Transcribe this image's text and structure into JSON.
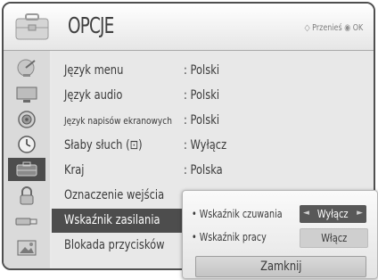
{
  "header": {
    "title": "OPCJE",
    "hint_move_symbol": "◇",
    "hint_move": "Przenieś",
    "hint_ok_symbol": "◉",
    "hint_ok": "OK"
  },
  "sidebar": {
    "items": [
      {
        "icon": "satellite-dish-icon"
      },
      {
        "icon": "monitor-icon"
      },
      {
        "icon": "speaker-icon"
      },
      {
        "icon": "clock-icon"
      },
      {
        "icon": "suitcase-icon",
        "active": true
      },
      {
        "icon": "lock-icon"
      },
      {
        "icon": "usb-icon"
      },
      {
        "icon": "photo-icon"
      }
    ]
  },
  "menu": {
    "items": [
      {
        "label": "Język menu",
        "value": ": Polski"
      },
      {
        "label": "Język audio",
        "value": ": Polski"
      },
      {
        "label": "Język napisów ekranowych",
        "value": ": Polski"
      },
      {
        "label": "Słaby słuch (⊡)",
        "value": ": Wyłącz"
      },
      {
        "label": "Kraj",
        "value": ": Polska"
      },
      {
        "label": "Oznaczenie wejścia",
        "value": ""
      },
      {
        "label": "Wskaźnik zasilania",
        "value": ""
      },
      {
        "label": "Blokada przycisków",
        "value": ""
      }
    ]
  },
  "popup": {
    "rows": [
      {
        "label": "• Wskaźnik czuwania",
        "value": "Wyłącz",
        "arrow_left": "◄",
        "arrow_right": "►"
      },
      {
        "label": "• Wskaźnik pracy",
        "value": "Włącz"
      }
    ],
    "close_label": "Zamknij"
  },
  "colors": {
    "selected_bg": "#4d4d4d",
    "frame_border": "#4f4f4f",
    "text": "#3a3a3a"
  }
}
